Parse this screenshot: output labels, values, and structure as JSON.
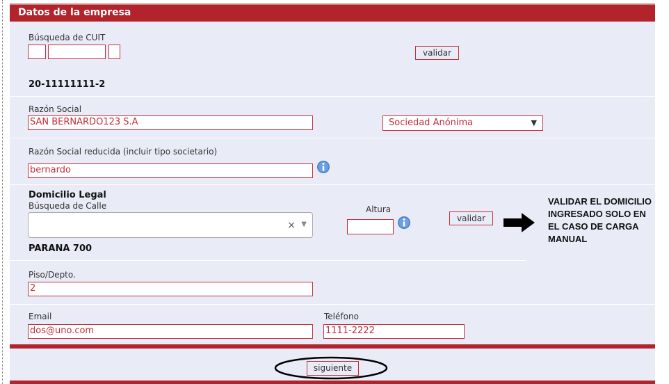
{
  "header": {
    "title": "Datos de la empresa"
  },
  "cuit": {
    "label": "Búsqueda de CUIT",
    "validate_label": "validar",
    "result": "20-11111111-2"
  },
  "razon_social": {
    "label": "Razón Social",
    "value": "SAN BERNARDO123 S.A",
    "type_selected": "Sociedad Anónima"
  },
  "razon_reducida": {
    "label": "Razón Social reducida (incluir tipo societario)",
    "value": "bernardo"
  },
  "domicilio": {
    "title": "Domicilio Legal",
    "street_label": "Búsqueda de Calle",
    "street_value": "",
    "altura_label": "Altura",
    "altura_value": "",
    "validate_label": "validar",
    "result": "PARANA 700",
    "clear_symbol": "×",
    "dropdown_symbol": "▼"
  },
  "piso": {
    "label": "Piso/Depto.",
    "value": "2"
  },
  "contact": {
    "email_label": "Email",
    "email_value": "dos@uno.com",
    "phone_label": "Teléfono",
    "phone_value": "1111-2222"
  },
  "footer": {
    "next_label": "siguiente"
  },
  "annotation": {
    "text": "VALIDAR EL DOMICILIO\nINGRESADO SOLO EN\nEL CASO DE CARGA\nMANUAL"
  },
  "colors": {
    "accent": "#b3232c",
    "panel": "#e9ebf7",
    "input_border": "#c0303b"
  }
}
